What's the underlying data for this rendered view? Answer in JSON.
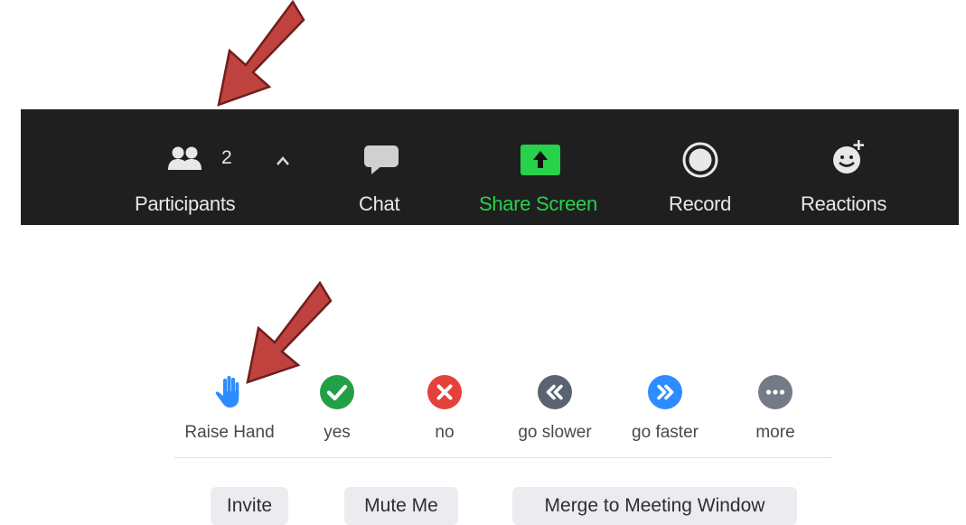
{
  "toolbar": {
    "participants": {
      "label": "Participants",
      "count": "2",
      "icon": "participants-icon"
    },
    "chat": {
      "label": "Chat",
      "icon": "chat-bubble-icon"
    },
    "share_screen": {
      "label": "Share Screen",
      "icon": "share-screen-arrow-icon"
    },
    "record": {
      "label": "Record",
      "icon": "record-icon"
    },
    "reactions": {
      "label": "Reactions",
      "icon": "emoji-plus-icon"
    },
    "colors": {
      "background": "#1f1f1f",
      "text": "#e8e8e8",
      "share_green": "#28d14a"
    }
  },
  "reactions_panel": {
    "items": [
      {
        "label": "Raise Hand",
        "icon": "raise-hand-icon",
        "color": "#2d8cff"
      },
      {
        "label": "yes",
        "icon": "check-icon",
        "color": "#23a046"
      },
      {
        "label": "no",
        "icon": "x-icon",
        "color": "#e5403a"
      },
      {
        "label": "go slower",
        "icon": "double-chevron-left-icon",
        "color": "#5b6270"
      },
      {
        "label": "go faster",
        "icon": "double-chevron-right-icon",
        "color": "#2d8cff"
      },
      {
        "label": "more",
        "icon": "ellipsis-icon",
        "color": "#747b86"
      }
    ],
    "buttons": {
      "invite": "Invite",
      "mute_me": "Mute Me",
      "merge": "Merge to Meeting Window"
    }
  },
  "annotations": {
    "arrow_color": "#c0423e"
  }
}
